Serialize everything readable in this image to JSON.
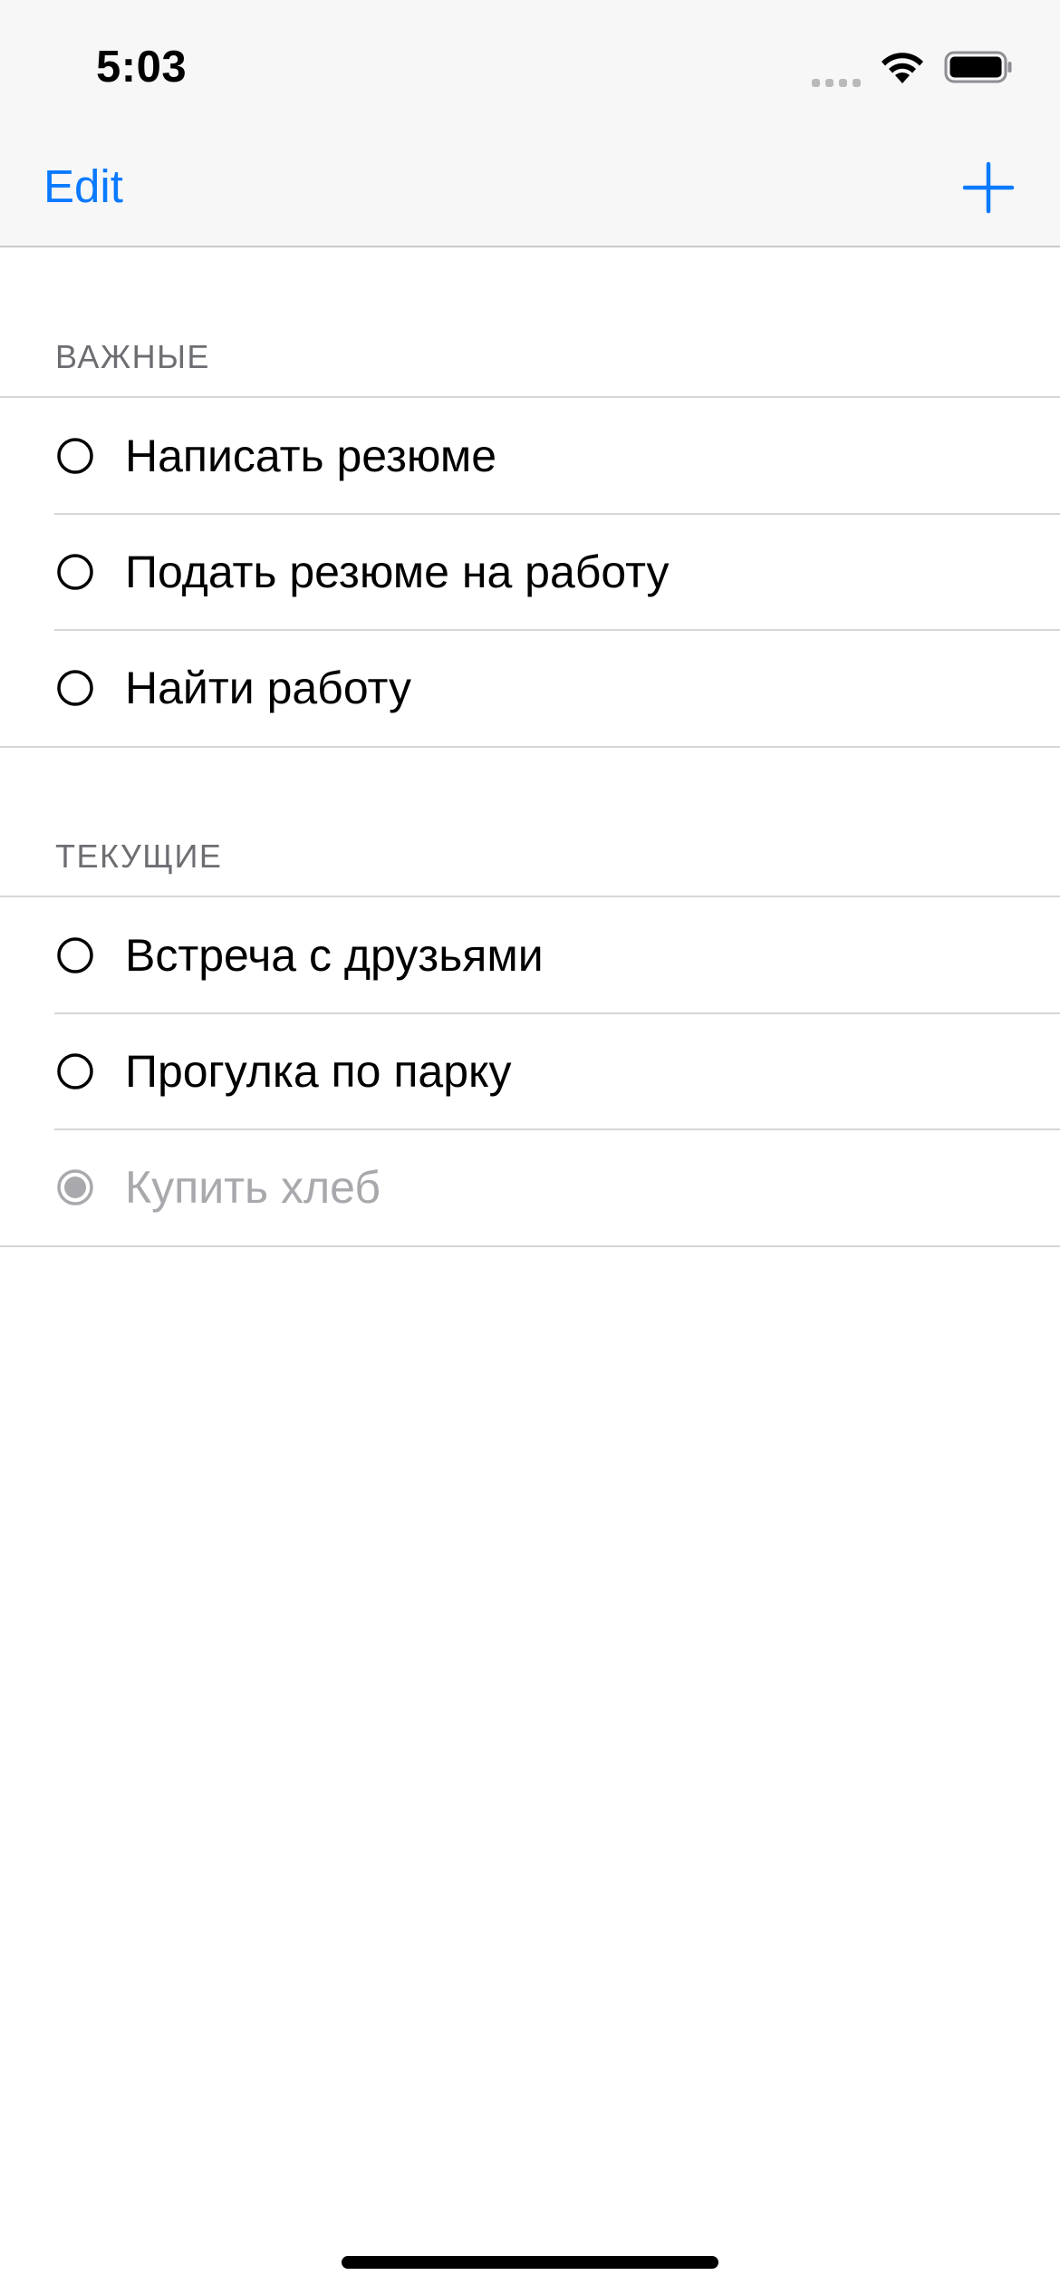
{
  "status_bar": {
    "time": "5:03",
    "signal_icon": "cellular-signal-icon",
    "wifi_icon": "wifi-icon",
    "battery_icon": "battery-icon"
  },
  "nav": {
    "edit_label": "Edit",
    "add_icon": "plus-icon"
  },
  "colors": {
    "accent": "#0a7aff",
    "header_text": "#6d6d72",
    "completed_text": "#a9a9ad",
    "separator": "#d6d6d9",
    "bar_background": "#f7f7f7"
  },
  "sections": [
    {
      "title": "ВАЖНЫЕ",
      "items": [
        {
          "label": "Написать резюме",
          "done": false
        },
        {
          "label": "Подать резюме на работу",
          "done": false
        },
        {
          "label": "Найти работу",
          "done": false
        }
      ]
    },
    {
      "title": "ТЕКУЩИЕ",
      "items": [
        {
          "label": "Встреча с друзьями",
          "done": false
        },
        {
          "label": "Прогулка по парку",
          "done": false
        },
        {
          "label": "Купить хлеб",
          "done": true
        }
      ]
    }
  ]
}
